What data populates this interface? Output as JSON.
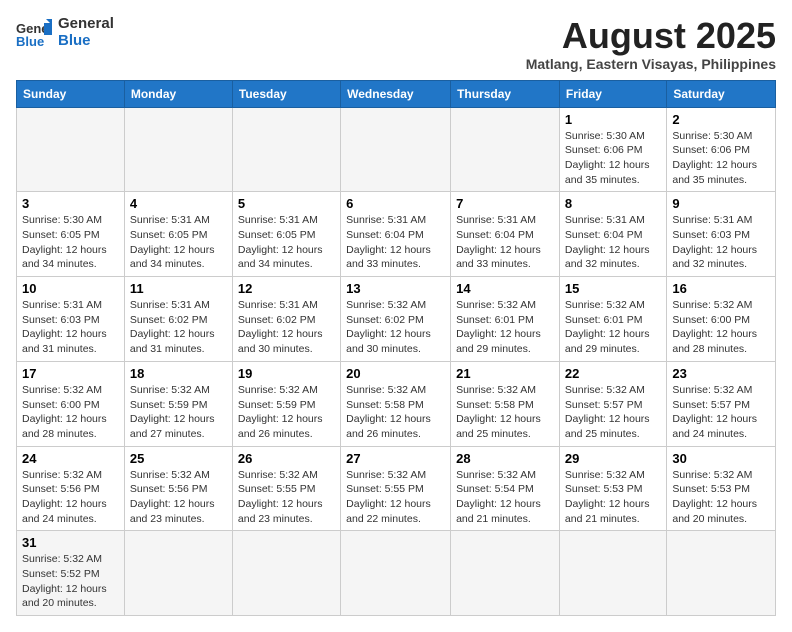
{
  "header": {
    "logo_general": "General",
    "logo_blue": "Blue",
    "month_year": "August 2025",
    "location": "Matlang, Eastern Visayas, Philippines"
  },
  "days_of_week": [
    "Sunday",
    "Monday",
    "Tuesday",
    "Wednesday",
    "Thursday",
    "Friday",
    "Saturday"
  ],
  "weeks": [
    [
      {
        "day": "",
        "info": ""
      },
      {
        "day": "",
        "info": ""
      },
      {
        "day": "",
        "info": ""
      },
      {
        "day": "",
        "info": ""
      },
      {
        "day": "",
        "info": ""
      },
      {
        "day": "1",
        "info": "Sunrise: 5:30 AM\nSunset: 6:06 PM\nDaylight: 12 hours and 35 minutes."
      },
      {
        "day": "2",
        "info": "Sunrise: 5:30 AM\nSunset: 6:06 PM\nDaylight: 12 hours and 35 minutes."
      }
    ],
    [
      {
        "day": "3",
        "info": "Sunrise: 5:30 AM\nSunset: 6:05 PM\nDaylight: 12 hours and 34 minutes."
      },
      {
        "day": "4",
        "info": "Sunrise: 5:31 AM\nSunset: 6:05 PM\nDaylight: 12 hours and 34 minutes."
      },
      {
        "day": "5",
        "info": "Sunrise: 5:31 AM\nSunset: 6:05 PM\nDaylight: 12 hours and 34 minutes."
      },
      {
        "day": "6",
        "info": "Sunrise: 5:31 AM\nSunset: 6:04 PM\nDaylight: 12 hours and 33 minutes."
      },
      {
        "day": "7",
        "info": "Sunrise: 5:31 AM\nSunset: 6:04 PM\nDaylight: 12 hours and 33 minutes."
      },
      {
        "day": "8",
        "info": "Sunrise: 5:31 AM\nSunset: 6:04 PM\nDaylight: 12 hours and 32 minutes."
      },
      {
        "day": "9",
        "info": "Sunrise: 5:31 AM\nSunset: 6:03 PM\nDaylight: 12 hours and 32 minutes."
      }
    ],
    [
      {
        "day": "10",
        "info": "Sunrise: 5:31 AM\nSunset: 6:03 PM\nDaylight: 12 hours and 31 minutes."
      },
      {
        "day": "11",
        "info": "Sunrise: 5:31 AM\nSunset: 6:02 PM\nDaylight: 12 hours and 31 minutes."
      },
      {
        "day": "12",
        "info": "Sunrise: 5:31 AM\nSunset: 6:02 PM\nDaylight: 12 hours and 30 minutes."
      },
      {
        "day": "13",
        "info": "Sunrise: 5:32 AM\nSunset: 6:02 PM\nDaylight: 12 hours and 30 minutes."
      },
      {
        "day": "14",
        "info": "Sunrise: 5:32 AM\nSunset: 6:01 PM\nDaylight: 12 hours and 29 minutes."
      },
      {
        "day": "15",
        "info": "Sunrise: 5:32 AM\nSunset: 6:01 PM\nDaylight: 12 hours and 29 minutes."
      },
      {
        "day": "16",
        "info": "Sunrise: 5:32 AM\nSunset: 6:00 PM\nDaylight: 12 hours and 28 minutes."
      }
    ],
    [
      {
        "day": "17",
        "info": "Sunrise: 5:32 AM\nSunset: 6:00 PM\nDaylight: 12 hours and 28 minutes."
      },
      {
        "day": "18",
        "info": "Sunrise: 5:32 AM\nSunset: 5:59 PM\nDaylight: 12 hours and 27 minutes."
      },
      {
        "day": "19",
        "info": "Sunrise: 5:32 AM\nSunset: 5:59 PM\nDaylight: 12 hours and 26 minutes."
      },
      {
        "day": "20",
        "info": "Sunrise: 5:32 AM\nSunset: 5:58 PM\nDaylight: 12 hours and 26 minutes."
      },
      {
        "day": "21",
        "info": "Sunrise: 5:32 AM\nSunset: 5:58 PM\nDaylight: 12 hours and 25 minutes."
      },
      {
        "day": "22",
        "info": "Sunrise: 5:32 AM\nSunset: 5:57 PM\nDaylight: 12 hours and 25 minutes."
      },
      {
        "day": "23",
        "info": "Sunrise: 5:32 AM\nSunset: 5:57 PM\nDaylight: 12 hours and 24 minutes."
      }
    ],
    [
      {
        "day": "24",
        "info": "Sunrise: 5:32 AM\nSunset: 5:56 PM\nDaylight: 12 hours and 24 minutes."
      },
      {
        "day": "25",
        "info": "Sunrise: 5:32 AM\nSunset: 5:56 PM\nDaylight: 12 hours and 23 minutes."
      },
      {
        "day": "26",
        "info": "Sunrise: 5:32 AM\nSunset: 5:55 PM\nDaylight: 12 hours and 23 minutes."
      },
      {
        "day": "27",
        "info": "Sunrise: 5:32 AM\nSunset: 5:55 PM\nDaylight: 12 hours and 22 minutes."
      },
      {
        "day": "28",
        "info": "Sunrise: 5:32 AM\nSunset: 5:54 PM\nDaylight: 12 hours and 21 minutes."
      },
      {
        "day": "29",
        "info": "Sunrise: 5:32 AM\nSunset: 5:53 PM\nDaylight: 12 hours and 21 minutes."
      },
      {
        "day": "30",
        "info": "Sunrise: 5:32 AM\nSunset: 5:53 PM\nDaylight: 12 hours and 20 minutes."
      }
    ],
    [
      {
        "day": "31",
        "info": "Sunrise: 5:32 AM\nSunset: 5:52 PM\nDaylight: 12 hours and 20 minutes."
      },
      {
        "day": "",
        "info": ""
      },
      {
        "day": "",
        "info": ""
      },
      {
        "day": "",
        "info": ""
      },
      {
        "day": "",
        "info": ""
      },
      {
        "day": "",
        "info": ""
      },
      {
        "day": "",
        "info": ""
      }
    ]
  ]
}
